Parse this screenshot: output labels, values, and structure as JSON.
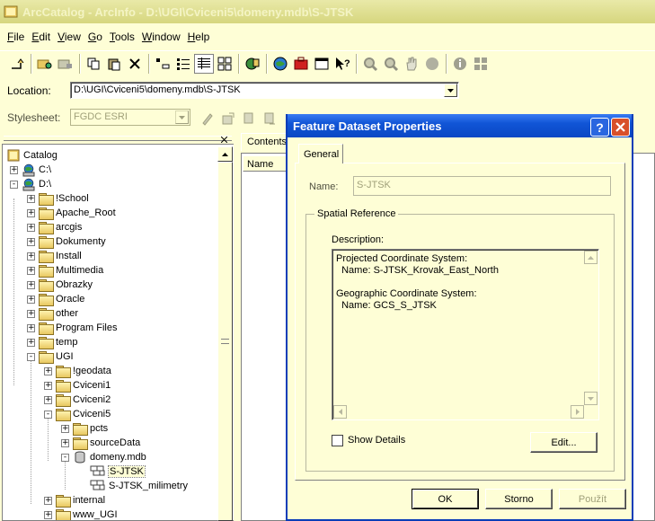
{
  "window": {
    "title": "ArcCatalog - ArcInfo - D:\\UGI\\Cviceni5\\domeny.mdb\\S-JTSK"
  },
  "menu": [
    {
      "label": "File",
      "u": "F",
      "rest": "ile"
    },
    {
      "label": "Edit",
      "u": "E",
      "rest": "dit"
    },
    {
      "label": "View",
      "u": "V",
      "rest": "iew"
    },
    {
      "label": "Go",
      "u": "G",
      "rest": "o"
    },
    {
      "label": "Tools",
      "u": "T",
      "rest": "ools"
    },
    {
      "label": "Window",
      "u": "W",
      "rest": "indow"
    },
    {
      "label": "Help",
      "u": "H",
      "rest": "elp"
    }
  ],
  "location": {
    "label": "Location:",
    "value": "D:\\UGI\\Cviceni5\\domeny.mdb\\S-JTSK"
  },
  "stylesheet": {
    "label": "Stylesheet:",
    "value": "FGDC ESRI"
  },
  "tree": [
    {
      "label": "Catalog",
      "level": 0,
      "icon": "catalog-icon",
      "pm": ""
    },
    {
      "label": "C:\\",
      "level": 1,
      "icon": "drive-icon",
      "pm": "+"
    },
    {
      "label": "D:\\",
      "level": 1,
      "icon": "drive-icon",
      "pm": "-"
    },
    {
      "label": "!School",
      "level": 2,
      "icon": "folder-icon",
      "pm": "+"
    },
    {
      "label": "Apache_Root",
      "level": 2,
      "icon": "folder-icon",
      "pm": "+"
    },
    {
      "label": "arcgis",
      "level": 2,
      "icon": "folder-icon",
      "pm": "+"
    },
    {
      "label": "Dokumenty",
      "level": 2,
      "icon": "folder-icon",
      "pm": "+"
    },
    {
      "label": "Install",
      "level": 2,
      "icon": "folder-icon",
      "pm": "+"
    },
    {
      "label": "Multimedia",
      "level": 2,
      "icon": "folder-icon",
      "pm": "+"
    },
    {
      "label": "Obrazky",
      "level": 2,
      "icon": "folder-icon",
      "pm": "+"
    },
    {
      "label": "Oracle",
      "level": 2,
      "icon": "folder-icon",
      "pm": "+"
    },
    {
      "label": "other",
      "level": 2,
      "icon": "folder-icon",
      "pm": "+"
    },
    {
      "label": "Program Files",
      "level": 2,
      "icon": "folder-icon",
      "pm": "+"
    },
    {
      "label": "temp",
      "level": 2,
      "icon": "folder-icon",
      "pm": "+"
    },
    {
      "label": "UGI",
      "level": 2,
      "icon": "folder-icon",
      "pm": "-"
    },
    {
      "label": "!geodata",
      "level": 3,
      "icon": "folder-icon",
      "pm": "+"
    },
    {
      "label": "Cviceni1",
      "level": 3,
      "icon": "folder-icon",
      "pm": "+"
    },
    {
      "label": "Cviceni2",
      "level": 3,
      "icon": "folder-icon",
      "pm": "+"
    },
    {
      "label": "Cviceni5",
      "level": 3,
      "icon": "folder-icon",
      "pm": "-"
    },
    {
      "label": "pcts",
      "level": 4,
      "icon": "folder-icon",
      "pm": "+"
    },
    {
      "label": "sourceData",
      "level": 4,
      "icon": "folder-icon",
      "pm": "+"
    },
    {
      "label": "domeny.mdb",
      "level": 4,
      "icon": "database-icon",
      "pm": "-"
    },
    {
      "label": "S-JTSK",
      "level": 5,
      "icon": "domain-icon",
      "pm": "",
      "selected": true
    },
    {
      "label": "S-JTSK_milimetry",
      "level": 5,
      "icon": "domain-icon",
      "pm": ""
    },
    {
      "label": "internal",
      "level": 3,
      "icon": "folder-icon",
      "pm": "+"
    },
    {
      "label": "www_UGI",
      "level": 3,
      "icon": "folder-icon",
      "pm": "+"
    }
  ],
  "contents": {
    "tab_label": "Contents",
    "column_name": "Name"
  },
  "dialog": {
    "title": "Feature Dataset Properties",
    "help_label": "?",
    "tab_label": "General",
    "name_label": "Name:",
    "name_value": "S-JTSK",
    "group_title": "Spatial Reference",
    "description_label": "Description:",
    "description_text": "Projected Coordinate System:\n  Name: S-JTSK_Krovak_East_North\n\nGeographic Coordinate System:\n  Name: GCS_S_JTSK",
    "show_details_label": "Show Details",
    "edit_label": "Edit...",
    "ok_label": "OK",
    "cancel_label": "Storno",
    "apply_label": "Použít"
  }
}
